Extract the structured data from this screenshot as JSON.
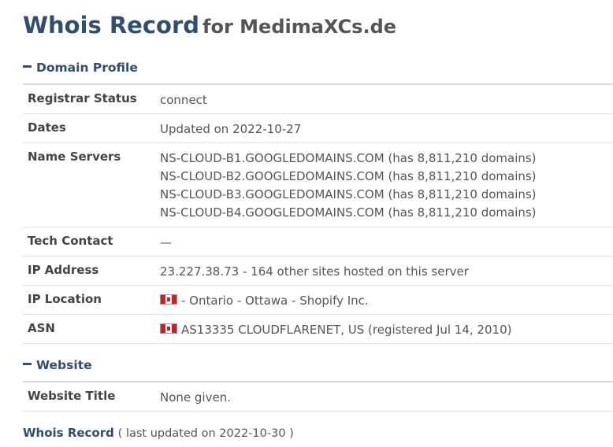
{
  "header": {
    "title": "Whois Record",
    "subtitle": "for MedimaXCs.de"
  },
  "domain_profile": {
    "heading": "Domain Profile",
    "rows": {
      "registrar_status": {
        "label": "Registrar Status",
        "value": "connect"
      },
      "dates": {
        "label": "Dates",
        "value": "Updated on 2022-10-27"
      },
      "name_servers": {
        "label": "Name Servers",
        "values": [
          "NS-CLOUD-B1.GOOGLEDOMAINS.COM (has 8,811,210 domains)",
          "NS-CLOUD-B2.GOOGLEDOMAINS.COM (has 8,811,210 domains)",
          "NS-CLOUD-B3.GOOGLEDOMAINS.COM (has 8,811,210 domains)",
          "NS-CLOUD-B4.GOOGLEDOMAINS.COM (has 8,811,210 domains)"
        ]
      },
      "tech_contact": {
        "label": "Tech Contact",
        "value": "—"
      },
      "ip_address": {
        "label": "IP Address",
        "value": "23.227.38.73 - 164 other sites hosted on this server"
      },
      "ip_location": {
        "label": "IP Location",
        "value": "- Ontario - Ottawa - Shopify Inc.",
        "flag_icon": "canada-flag-icon"
      },
      "asn": {
        "label": "ASN",
        "value": "AS13335 CLOUDFLARENET, US (registered Jul 14, 2010)",
        "flag_icon": "canada-flag-icon"
      }
    }
  },
  "website": {
    "heading": "Website",
    "rows": {
      "website_title": {
        "label": "Website Title",
        "value": "None given."
      }
    }
  },
  "footer": {
    "link": "Whois Record",
    "note": "( last updated on 2022-10-30 )"
  },
  "colors": {
    "heading": "#304e70",
    "text": "#444444",
    "border": "#d7d7d7"
  }
}
